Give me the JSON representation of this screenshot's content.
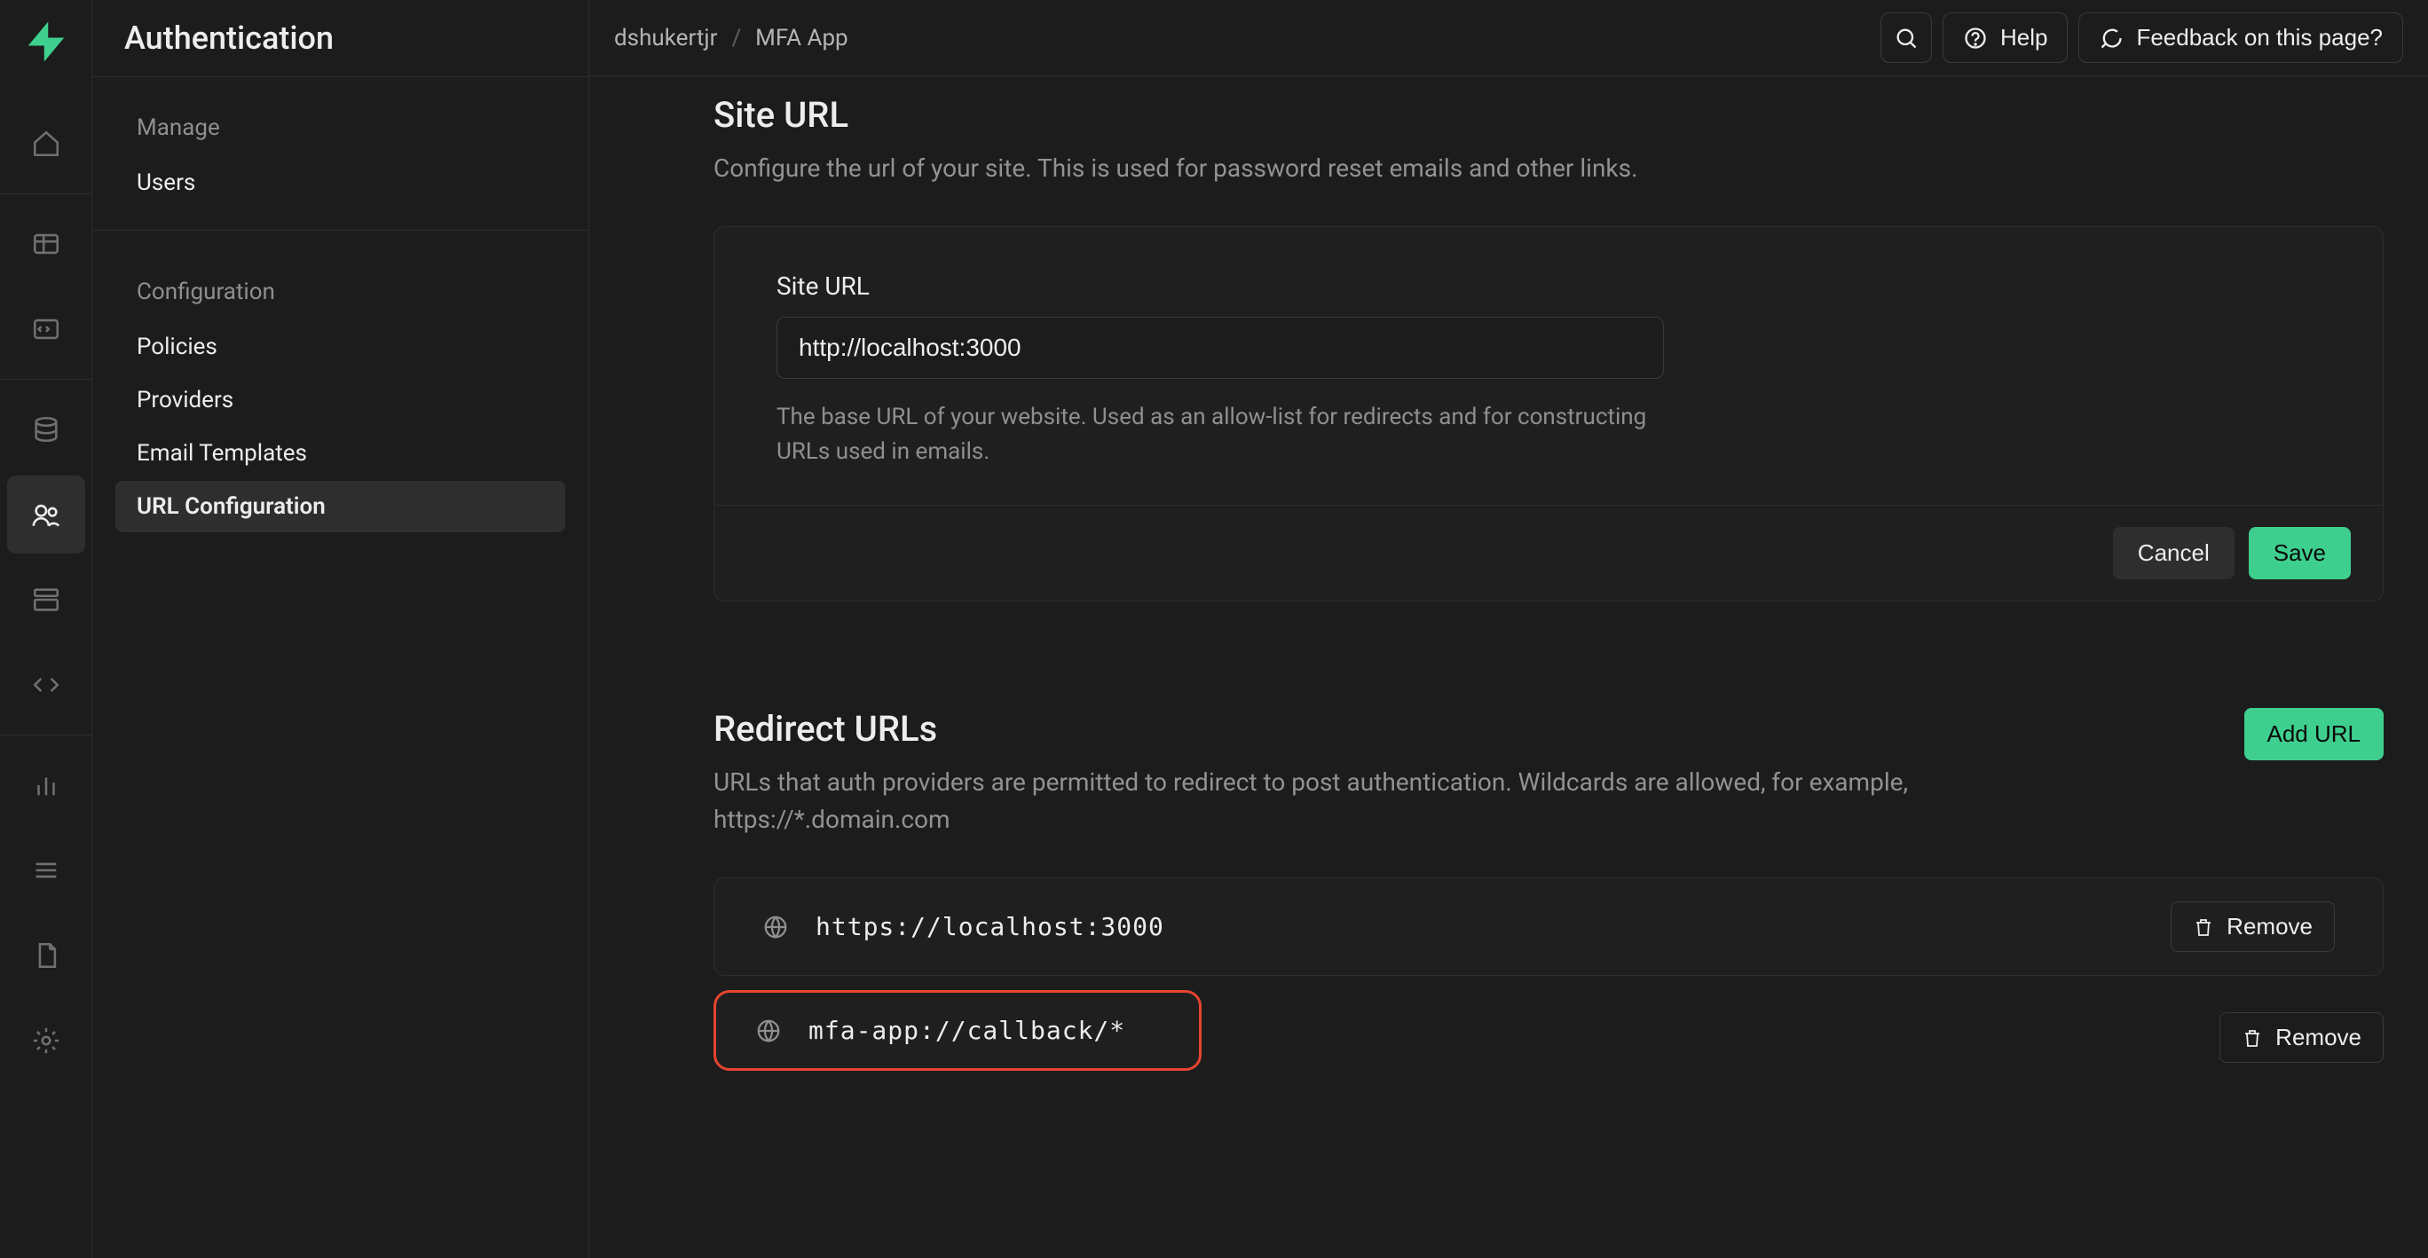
{
  "page_title": "Authentication",
  "breadcrumb": {
    "org": "dshukertjr",
    "project": "MFA App"
  },
  "topbar": {
    "help_label": "Help",
    "feedback_label": "Feedback on this page?"
  },
  "sidebar": {
    "sections": [
      {
        "title": "Manage",
        "items": [
          {
            "label": "Users"
          }
        ]
      },
      {
        "title": "Configuration",
        "items": [
          {
            "label": "Policies"
          },
          {
            "label": "Providers"
          },
          {
            "label": "Email Templates"
          },
          {
            "label": "URL Configuration",
            "active": true
          }
        ]
      }
    ]
  },
  "site_url_section": {
    "title": "Site URL",
    "description": "Configure the url of your site. This is used for password reset emails and other links.",
    "field_label": "Site URL",
    "value": "http://localhost:3000",
    "help": "The base URL of your website. Used as an allow-list for redirects and for constructing URLs used in emails.",
    "cancel": "Cancel",
    "save": "Save"
  },
  "redirect_section": {
    "title": "Redirect URLs",
    "description": "URLs that auth providers are permitted to redirect to post authentication. Wildcards are allowed, for example, https://*.domain.com",
    "add_label": "Add URL",
    "remove_label": "Remove",
    "urls": [
      {
        "value": "https://localhost:3000",
        "highlight": false
      },
      {
        "value": "mfa-app://callback/*",
        "highlight": true
      }
    ]
  },
  "colors": {
    "accent": "#3ecf8e",
    "highlight": "#e74430"
  }
}
